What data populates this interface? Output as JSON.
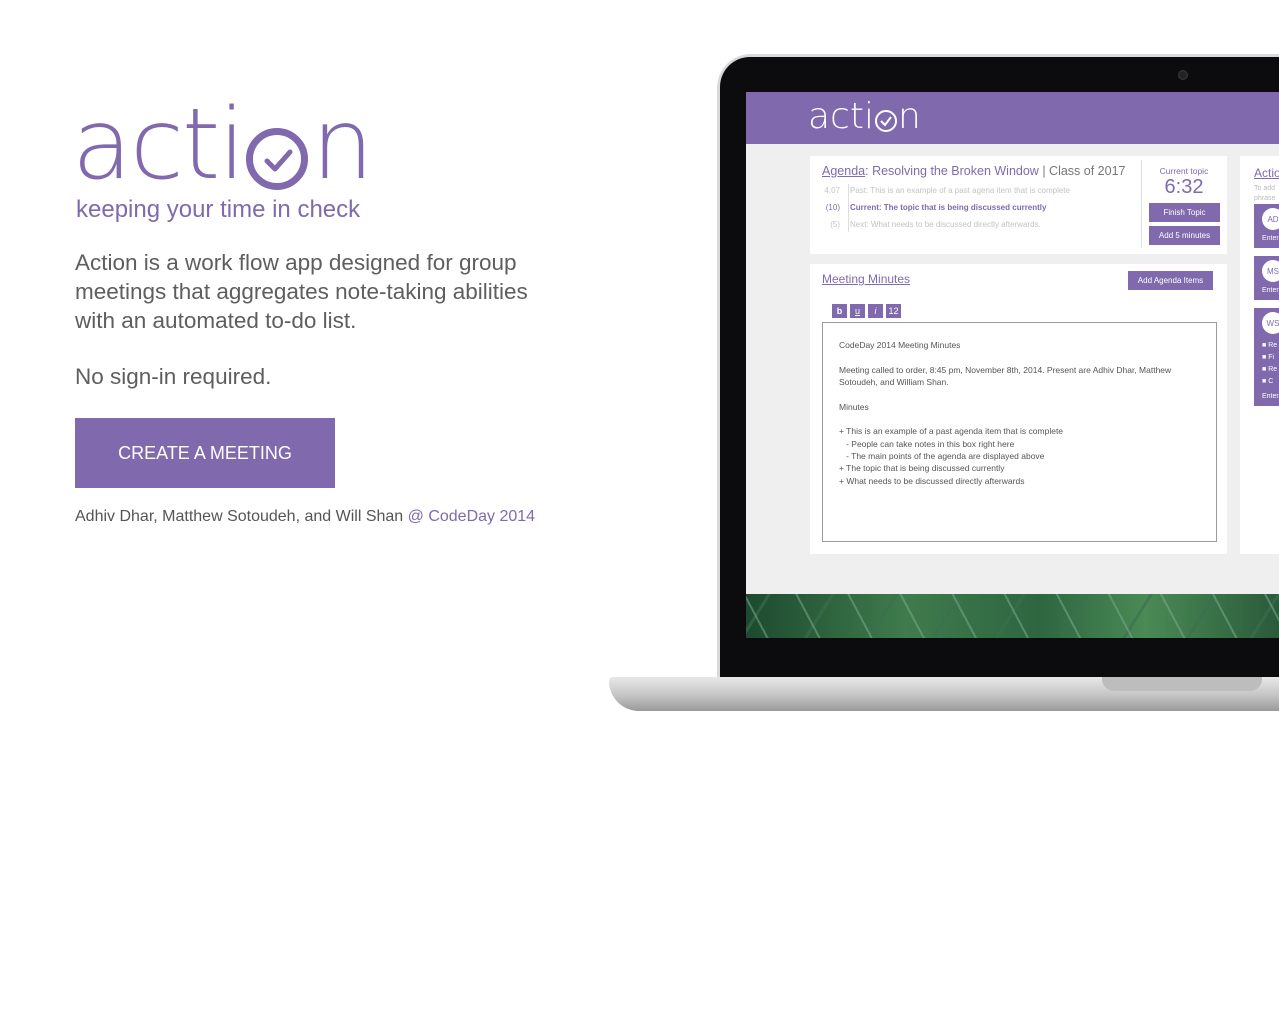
{
  "hero": {
    "logo_text_before": "acti",
    "logo_text_after": "n",
    "tagline": "keeping your time in check",
    "description": "Action is a work flow app designed for group meetings that aggregates note-taking abilities with an automated to-do list.",
    "no_signin": "No sign-in required.",
    "cta_label": "CREATE A MEETING",
    "credits_names": "Adhiv Dhar, Matthew Sotoudeh, and Will Shan",
    "credits_event": "@ CodeDay 2014"
  },
  "screen": {
    "logo_before": "acti",
    "logo_after": "n",
    "agenda": {
      "label": "Agenda",
      "colon": ":",
      "title": "Resolving the Broken Window",
      "separator": "|",
      "class_name": "Class of 2017",
      "items": [
        {
          "time": "4:07",
          "text": "Past: This is an example of a past agena item that is complete"
        },
        {
          "time": "(10)",
          "text": "Current: The topic that is being discussed currently"
        },
        {
          "time": "(5)",
          "text": "Next: What needs to be discussed directly afterwards."
        }
      ],
      "current_label": "Current topic",
      "current_time": "6:32",
      "finish_label": "Finish Topic",
      "add_label": "Add 5 minutes"
    },
    "minutes": {
      "title": "Meeting Minutes",
      "add_agenda_label": "Add Agenda Items",
      "tools": [
        "b",
        "u",
        "i",
        "12"
      ],
      "notes": {
        "heading": "CodeDay 2014 Meeting Minutes",
        "paragraph": "Meeting called to order, 8:45 pm, November 8th, 2014. Present are Adhiv Dhar, Matthew Sotoudeh, and William Shan.",
        "minutes_label": "Minutes",
        "lines": [
          "+ This is an example of a past agenda item that is complete",
          "   - People can take notes in this box right here",
          "   - The main points of the agenda are displayed above",
          "+ The topic that is being discussed currently",
          "+ What needs to be discussed directly afterwards"
        ]
      }
    },
    "side": {
      "title": "Actio",
      "sub1": "To add",
      "sub2": "phrase",
      "avatars": [
        "AD",
        "MS",
        "WS"
      ],
      "enter": "Enter",
      "bullets": [
        "Re",
        "Fi",
        "Re",
        "C"
      ]
    }
  },
  "colors": {
    "brand": "#8069ad",
    "text": "#5e5e5e"
  }
}
